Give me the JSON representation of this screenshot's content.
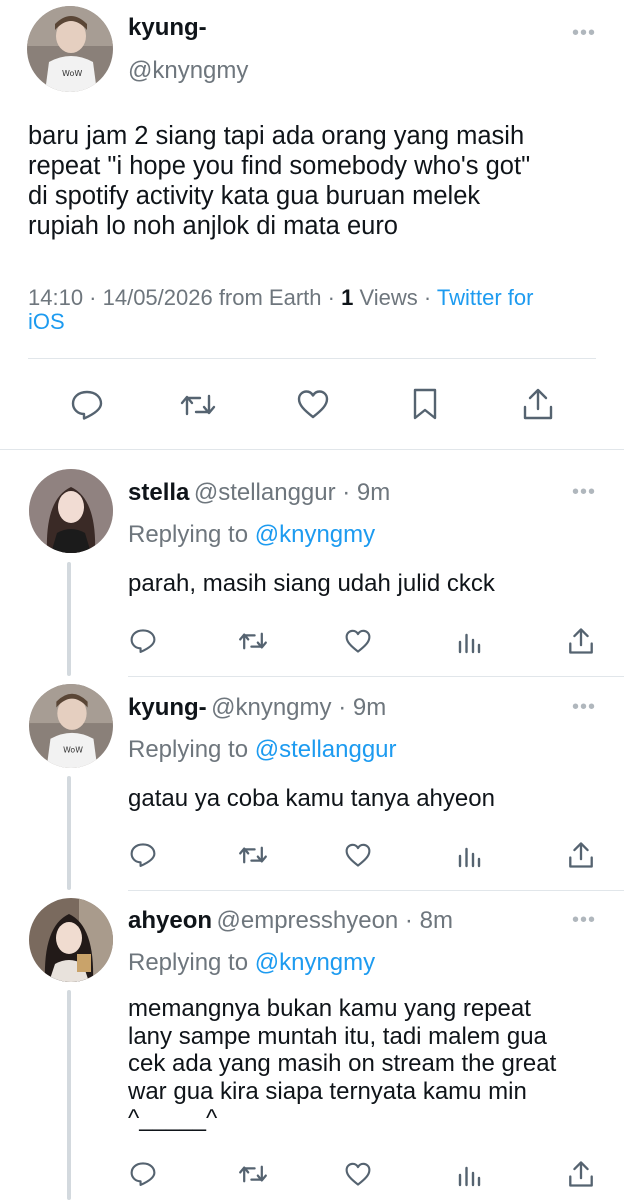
{
  "main_tweet": {
    "display_name": "kyung-",
    "handle": "@knyngmy",
    "text_lines": [
      "baru jam 2 siang tapi ada orang yang masih",
      "repeat \"i hope you find somebody who's got\"",
      "di spotify activity kata gua buruan melek",
      "rupiah lo noh anjlok di mata euro"
    ],
    "meta": {
      "time_date": "14:10 · 14/05/2026 from Earth · ",
      "views_count": "1",
      "views_label": " Views · ",
      "source_part1": "Twitter for",
      "source_part2": "iOS"
    },
    "actions": [
      "reply-icon",
      "retweet-icon",
      "like-icon",
      "bookmark-icon",
      "share-icon"
    ]
  },
  "replies": [
    {
      "display_name": "stella",
      "handle_time": "@stellanggur · 9m",
      "replying_prefix": "Replying to ",
      "replying_handle": "@knyngmy",
      "text_lines": [
        "parah, masih siang udah julid ckck"
      ]
    },
    {
      "display_name": "kyung-",
      "handle_time": "@knyngmy · 9m",
      "replying_prefix": "Replying to ",
      "replying_handle": "@stellanggur",
      "text_lines": [
        "gatau ya coba kamu tanya ahyeon"
      ]
    },
    {
      "display_name": "ahyeon",
      "handle_time": "@empresshyeon · 8m",
      "replying_prefix": "Replying to ",
      "replying_handle": "@knyngmy",
      "text_lines": [
        "memangnya bukan kamu yang repeat",
        "lany sampe muntah itu, tadi malem gua",
        "cek ada yang masih on stream the great",
        "war gua kira siapa ternyata kamu min",
        "^_____^"
      ]
    }
  ],
  "more_label": "•••",
  "colors": {
    "accent": "#1d9bf0",
    "secondary": "#6e767d",
    "divider": "#e1e6ea",
    "thread_line": "#d3d9de"
  }
}
